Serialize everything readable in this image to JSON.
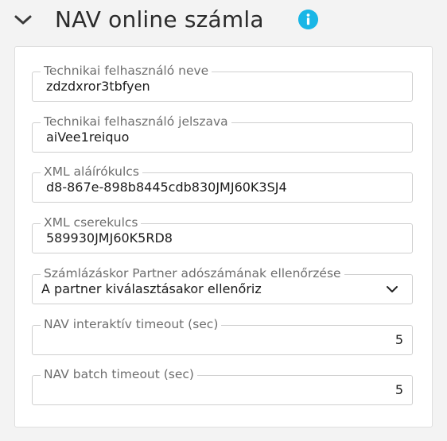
{
  "header": {
    "title": "NAV online számla",
    "collapse_icon": "chevron-down-icon",
    "info_icon": "info-icon",
    "info_color": "#19b6e6"
  },
  "fields": [
    {
      "label": "Technikai felhasználó neve",
      "value": "zdzdxror3tbfyen",
      "type": "text"
    },
    {
      "label": "Technikai felhasználó jelszava",
      "value": "aiVee1reiquo",
      "type": "text"
    },
    {
      "label": "XML aláírókulcs",
      "value": "d8-867e-898b8445cdb830JMJ60K3SJ4",
      "type": "text"
    },
    {
      "label": "XML cserekulcs",
      "value": "589930JMJ60K5RD8",
      "type": "text"
    },
    {
      "label": "Számlázáskor Partner adószámának ellenőrzése",
      "value": "A partner kiválasztásakor ellenőriz",
      "type": "select"
    },
    {
      "label": "NAV interaktív timeout (sec)",
      "value": "5",
      "type": "number"
    },
    {
      "label": "NAV batch timeout (sec)",
      "value": "5",
      "type": "number"
    }
  ]
}
